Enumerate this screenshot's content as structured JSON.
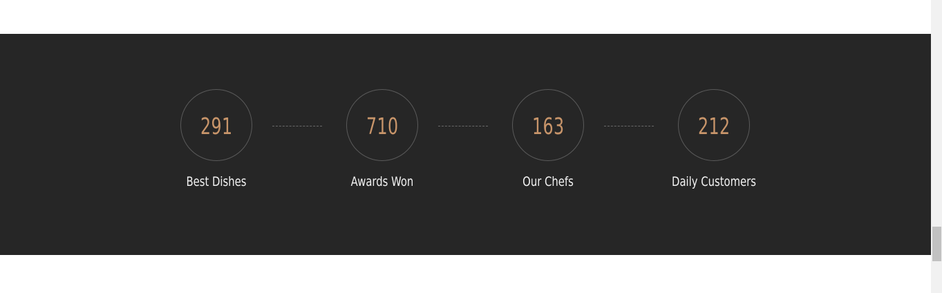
{
  "stats": [
    {
      "number": "291",
      "label": "Best Dishes"
    },
    {
      "number": "710",
      "label": "Awards Won"
    },
    {
      "number": "163",
      "label": "Our Chefs"
    },
    {
      "number": "212",
      "label": "Daily Customers"
    }
  ],
  "colors": {
    "band_background": "#262626",
    "number_accent": "#c8956a",
    "label_text": "#f2f2f2",
    "circle_border": "#5a5a5a",
    "page_background": "#ffffff"
  }
}
